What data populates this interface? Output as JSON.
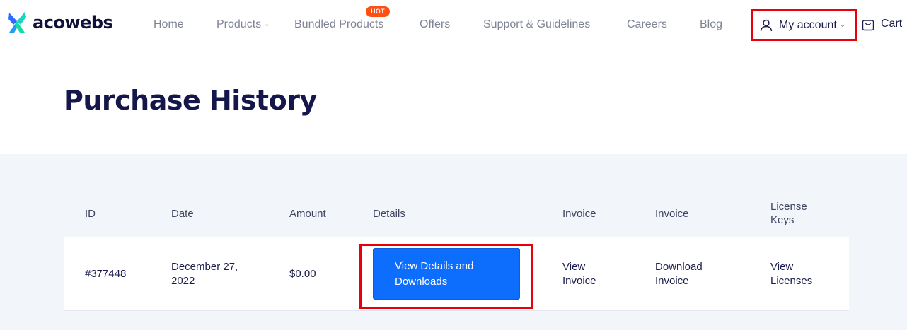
{
  "brand": {
    "name": "acowebs",
    "accent": "#0d6efd",
    "highlight": "#e8000b",
    "hot_color": "#ff4f12"
  },
  "nav": {
    "items": [
      {
        "label": "Home",
        "has_dropdown": false
      },
      {
        "label": "Products",
        "has_dropdown": true
      },
      {
        "label": "Bundled Products",
        "has_dropdown": false,
        "badge": "HOT"
      },
      {
        "label": "Offers",
        "has_dropdown": false
      },
      {
        "label": "Support & Guidelines",
        "has_dropdown": false
      },
      {
        "label": "Careers",
        "has_dropdown": false
      },
      {
        "label": "Blog",
        "has_dropdown": false
      }
    ],
    "account_label": "My account",
    "account_icon": "user-icon",
    "cart_label": "Cart",
    "cart_icon": "shopping-bag-icon"
  },
  "page": {
    "title": "Purchase History"
  },
  "table": {
    "headers": [
      "ID",
      "Date",
      "Amount",
      "Details",
      "Invoice",
      "Invoice",
      "License\nKeys"
    ],
    "rows": [
      {
        "id": "#377448",
        "date": "December 27, 2022",
        "amount": "$0.00",
        "details_button": "View Details and Downloads",
        "view_invoice": "View Invoice",
        "download_invoice": "Download Invoice",
        "licenses": "View Licenses"
      }
    ]
  }
}
